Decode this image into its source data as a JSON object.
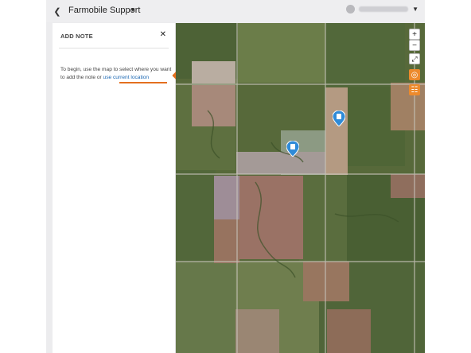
{
  "header": {
    "back_icon": "chevron-left-icon",
    "title": "Farmobile Support",
    "title_caret_icon": "caret-down-icon",
    "user_caret_icon": "caret-down-icon"
  },
  "panel": {
    "title": "ADD NOTE",
    "close_icon": "close-icon",
    "instruction_prefix": "To begin, use the map to select where you want to add the note or",
    "instruction_link": "use current location"
  },
  "map_controls": {
    "zoom_in": "+",
    "zoom_out": "−",
    "fullscreen_icon": "fullscreen-icon",
    "locate_icon": "locate-icon",
    "layers_icon": "layers-icon"
  },
  "map_pins": [
    {
      "name": "note-pin-1",
      "icon": "note-pin-icon"
    },
    {
      "name": "note-pin-2",
      "icon": "note-pin-icon"
    }
  ],
  "colors": {
    "accent": "#ec8a2c",
    "link": "#1a67b3",
    "pin": "#2f8bd8",
    "annotation_arrow": "#e46f1f"
  }
}
